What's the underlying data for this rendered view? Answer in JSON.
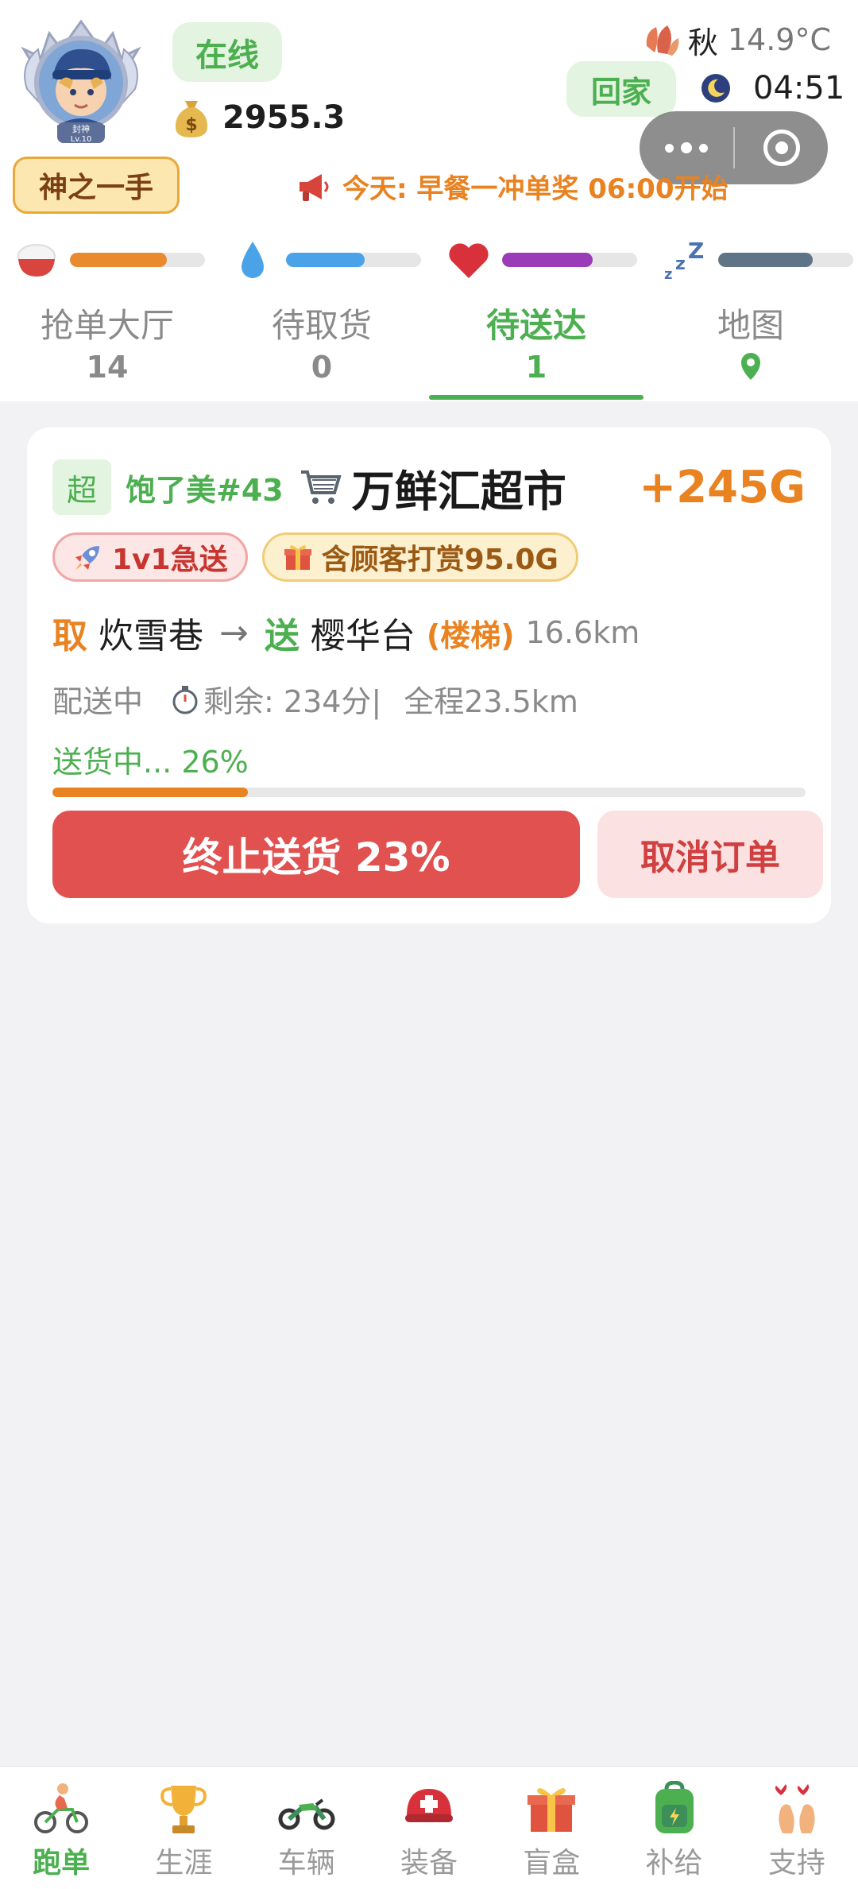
{
  "header": {
    "avatar_level_title": "封神",
    "avatar_level": "Lv.10",
    "status": "在线",
    "money": "2955.3",
    "title_badge": "神之一手",
    "season": "秋",
    "temperature": "14.9°C",
    "home_button": "回家",
    "time": "04:51",
    "announcement": "今天: 早餐一冲单奖 06:00开始"
  },
  "stats": [
    {
      "name": "food",
      "level": 0.72,
      "color": "#e98a2e"
    },
    {
      "name": "water",
      "level": 0.58,
      "color": "#4aa3e8"
    },
    {
      "name": "health",
      "level": 0.67,
      "color": "#9a3bb8"
    },
    {
      "name": "sleep",
      "level": 0.7,
      "color": "#5f7486"
    }
  ],
  "tabs": [
    {
      "label": "抢单大厅",
      "count": "14"
    },
    {
      "label": "待取货",
      "count": "0"
    },
    {
      "label": "待送达",
      "count": "1",
      "active": true
    },
    {
      "label": "地图",
      "icon": "map-pin-icon"
    }
  ],
  "order": {
    "tag": "超",
    "shop_tag": "饱了美#43",
    "shop_name": "万鲜汇超市",
    "reward": "+245G",
    "chip_urgent": "1v1急送",
    "chip_tip": "含顾客打赏95.0G",
    "pickup_label": "取",
    "pickup_place": "炊雪巷",
    "arrow": "→",
    "deliver_label": "送",
    "deliver_place": "樱华台",
    "stairs": "(楼梯)",
    "distance": "16.6km",
    "status": "配送中",
    "remaining": "剩余: 234分|",
    "total": "全程23.5km",
    "progress_text": "送货中... 26%",
    "progress": 0.26,
    "stop_button": "终止送货 23%",
    "cancel_button": "取消订单"
  },
  "bottom_nav": [
    {
      "label": "跑单",
      "icon": "cyclist-icon",
      "active": true
    },
    {
      "label": "生涯",
      "icon": "trophy-icon"
    },
    {
      "label": "车辆",
      "icon": "motorcycle-icon"
    },
    {
      "label": "装备",
      "icon": "helmet-icon"
    },
    {
      "label": "盲盒",
      "icon": "gift-icon"
    },
    {
      "label": "补给",
      "icon": "backpack-icon"
    },
    {
      "label": "支持",
      "icon": "heart-hands-icon"
    }
  ]
}
